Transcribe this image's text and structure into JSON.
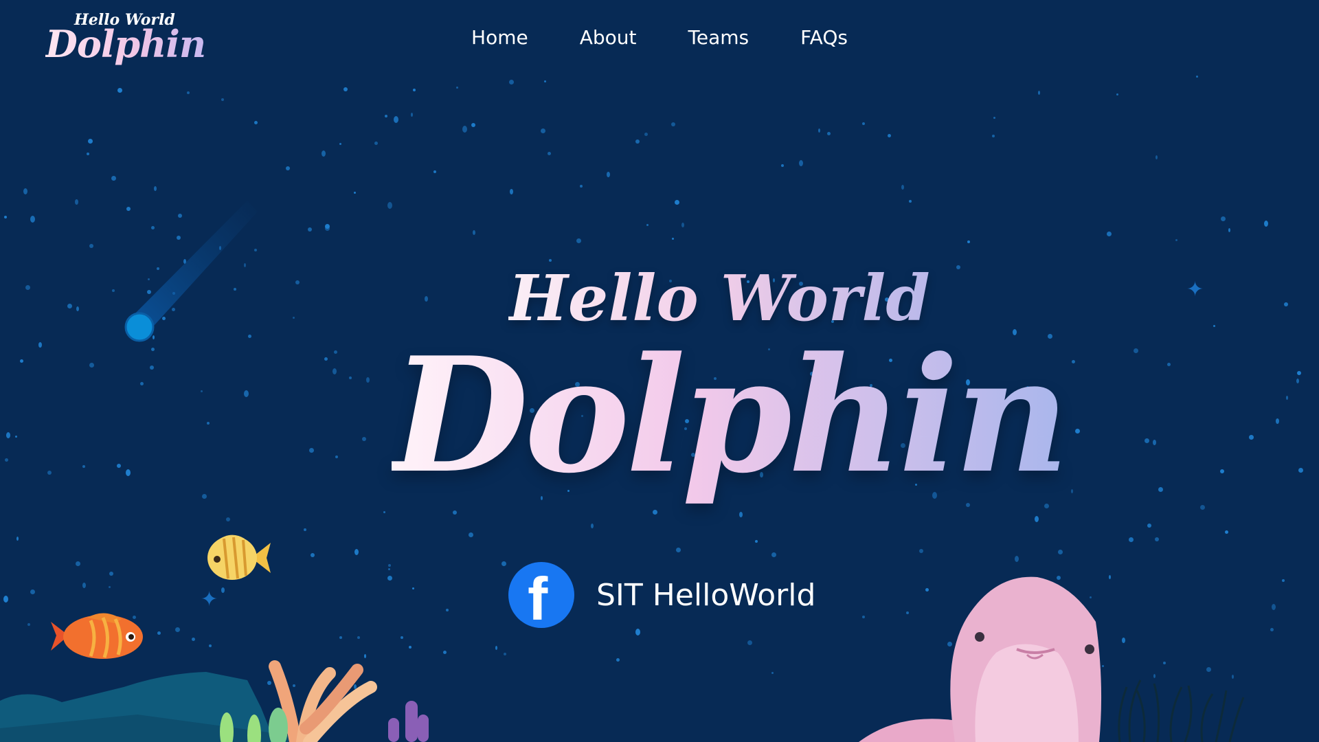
{
  "logo": {
    "line1": "Hello World",
    "line2": "Dolphin"
  },
  "nav": [
    {
      "label": "Home"
    },
    {
      "label": "About"
    },
    {
      "label": "Teams"
    },
    {
      "label": "FAQs"
    }
  ],
  "hero": {
    "line1": "Hello World",
    "line2": "Dolphin"
  },
  "social": {
    "icon": "facebook-icon",
    "label": "SIT HelloWorld"
  },
  "colors": {
    "background": "#072a55",
    "accent": "#f2c7e6",
    "facebook": "#1877f2"
  }
}
